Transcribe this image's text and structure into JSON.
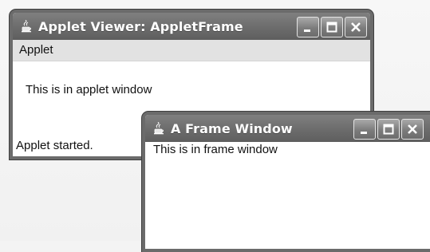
{
  "applet_window": {
    "title": "Applet Viewer: AppletFrame",
    "menu": {
      "applet_label": "Applet"
    },
    "content_text": "This is in applet window",
    "status_text": "Applet started.",
    "icon": "java-cup-icon",
    "controls": [
      "minimize-icon",
      "maximize-icon",
      "close-icon"
    ]
  },
  "frame_window": {
    "title": "A Frame Window",
    "content_text": "This is in frame window",
    "icon": "java-cup-icon",
    "controls": [
      "minimize-icon",
      "maximize-icon",
      "close-icon"
    ]
  },
  "colors": {
    "titlebar": "#6e6e6e",
    "border": "#6b6b6b",
    "menubar": "#e2e2e2",
    "window_bg": "#ffffff"
  }
}
